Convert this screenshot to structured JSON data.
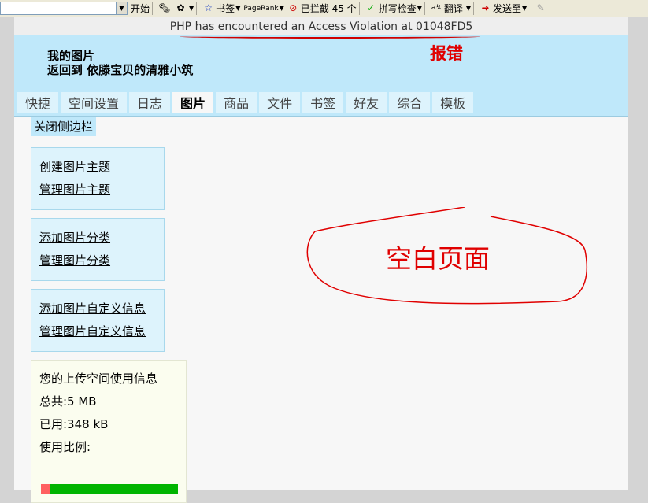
{
  "toolbar": {
    "start": "开始",
    "bookmarks": "书签",
    "pagerank": "PageRank",
    "blocked": "已拦截 45 个",
    "spellcheck": "拼写检查",
    "translate": "翻译",
    "send_to": "发送至"
  },
  "error": {
    "message": "PHP has encountered an Access Violation at 01048FD5",
    "annotation": "报错"
  },
  "header": {
    "title": "我的图片",
    "back_link": "返回到  依滕宝贝的清雅小筑"
  },
  "tabs": [
    {
      "label": "快捷"
    },
    {
      "label": "空间设置"
    },
    {
      "label": "日志"
    },
    {
      "label": "图片",
      "active": true
    },
    {
      "label": "商品"
    },
    {
      "label": "文件"
    },
    {
      "label": "书签"
    },
    {
      "label": "好友"
    },
    {
      "label": "综合"
    },
    {
      "label": "模板"
    }
  ],
  "sidebar": {
    "close_label": "关闭侧边栏",
    "box1": [
      "创建图片主题",
      "管理图片主题"
    ],
    "box2": [
      "添加图片分类",
      "管理图片分类"
    ],
    "box3": [
      "添加图片自定义信息",
      "管理图片自定义信息"
    ]
  },
  "usage": {
    "title": "您的上传空间使用信息",
    "total": "总共:5 MB",
    "used": "已用:348 kB",
    "ratio_label": "使用比例:",
    "ratio": 0.068
  },
  "blank_note": "空白页面"
}
